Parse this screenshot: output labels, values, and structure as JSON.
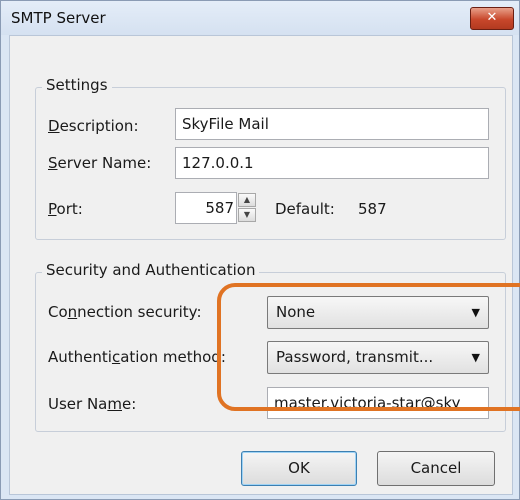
{
  "window": {
    "title": "SMTP Server",
    "close_label": "✕"
  },
  "settings": {
    "legend": "Settings",
    "description_label": "Description:",
    "description_value": "SkyFile Mail",
    "server_name_label": "Server Name:",
    "server_name_value": "127.0.0.1",
    "port_label": "Port:",
    "port_value": "587",
    "default_label": "Default:",
    "default_value": "587"
  },
  "security": {
    "legend": "Security and Authentication",
    "connection_label": "Connection security:",
    "connection_value": "None",
    "auth_label": "Authentication method:",
    "auth_value": "Password, transmit...",
    "username_label": "User Name:",
    "username_value": "master.victoria-star@sky"
  },
  "buttons": {
    "ok": "OK",
    "cancel": "Cancel"
  },
  "highlight_color": "#e07323"
}
